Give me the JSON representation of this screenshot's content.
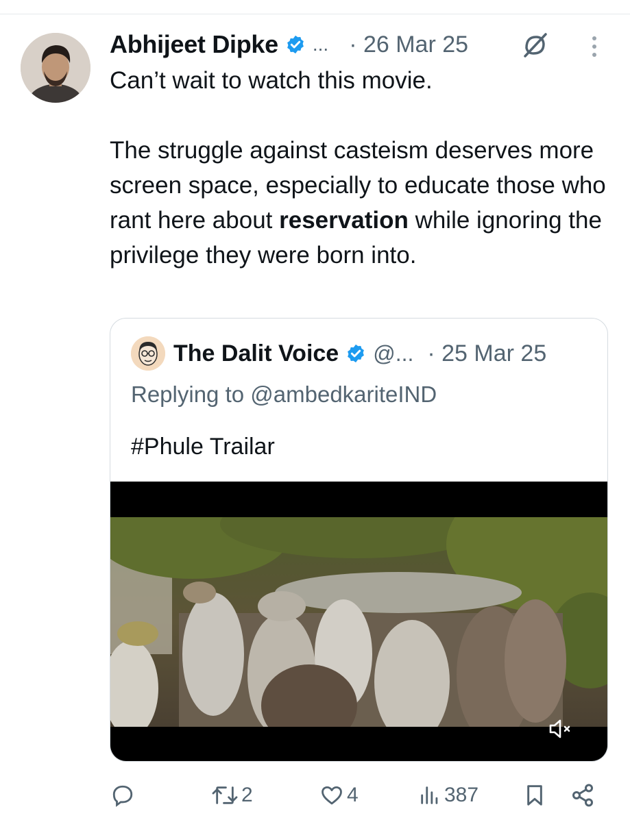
{
  "tweet": {
    "author_name": "Abhijeet Dipke",
    "handle": "...",
    "date": "· 26 Mar 25",
    "text_para1": "Can’t wait to watch this movie.",
    "text_para2_before": "The struggle against casteism deserves more screen space, especially to educate those who rant here about ",
    "text_para2_bold": "reservation",
    "text_para2_after": " while ignoring the privilege they were born into."
  },
  "quoted_tweet": {
    "author_name": "The Dalit Voice",
    "handle": "@...",
    "date": "· 25 Mar 25",
    "replying_to": "Replying to @ambedkariteIND",
    "text": "#Phule Trailar"
  },
  "actions": {
    "reply_count": "",
    "retweet_count": "2",
    "like_count": "4",
    "views_count": "387"
  },
  "colors": {
    "accent": "#1d9bf0",
    "text": "#0f1419",
    "secondary_text": "#536471",
    "border": "#d5dbe0"
  },
  "icons": [
    "verified-badge-icon",
    "grok-icon",
    "more-vertical-icon",
    "mute-icon",
    "reply-icon",
    "retweet-icon",
    "like-icon",
    "views-icon",
    "bookmark-icon",
    "share-icon"
  ]
}
